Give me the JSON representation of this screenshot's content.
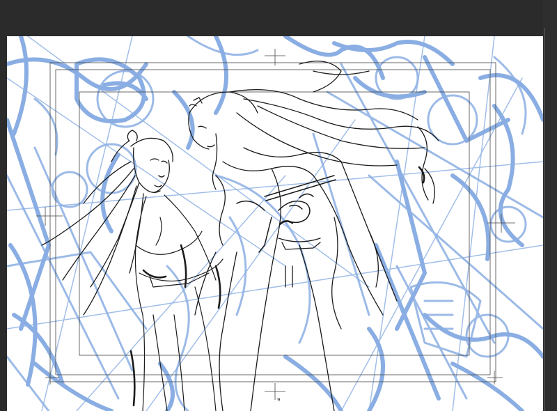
{
  "app": {
    "workspace_background": "#2b2b2b",
    "canvas_background": "#ffffff"
  },
  "artwork": {
    "style": "digital sketch on canvas",
    "rough_layer_color": "#7ea6e0",
    "lineart_color": "#1a1a1a",
    "guide_color": "#444444",
    "subjects": [
      "long-haired-figure-with-hair-ornament",
      "tall-figure-with-flowing-hair"
    ]
  },
  "canvas": {
    "page_number": "9"
  }
}
